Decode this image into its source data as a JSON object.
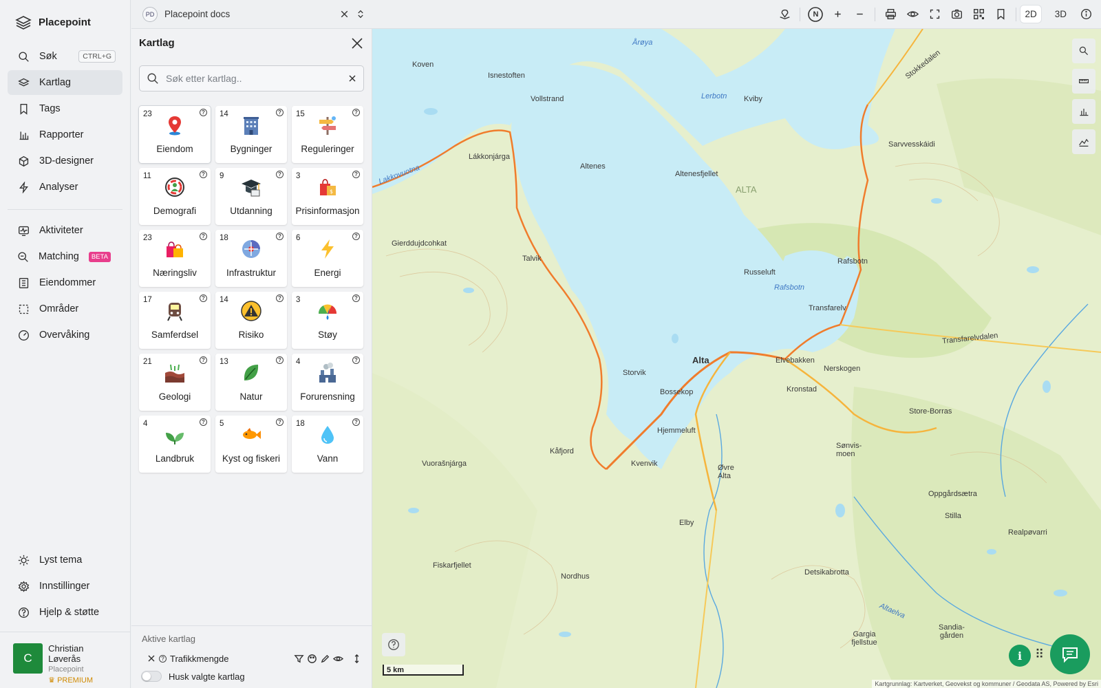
{
  "app": {
    "name": "Placepoint"
  },
  "nav": {
    "search": {
      "label": "Søk",
      "shortcut": "CTRL+G"
    },
    "items": [
      {
        "label": "Kartlag",
        "icon": "layers-icon",
        "active": true
      },
      {
        "label": "Tags",
        "icon": "bookmark-icon"
      },
      {
        "label": "Rapporter",
        "icon": "bar-chart-icon"
      },
      {
        "label": "3D-designer",
        "icon": "cube-icon"
      },
      {
        "label": "Analyser",
        "icon": "lightning-icon"
      }
    ],
    "items2": [
      {
        "label": "Aktiviteter",
        "icon": "activity-icon"
      },
      {
        "label": "Matching",
        "icon": "match-search-icon",
        "badge": "BETA"
      },
      {
        "label": "Eiendommer",
        "icon": "building-icon"
      },
      {
        "label": "Områder",
        "icon": "area-select-icon"
      },
      {
        "label": "Overvåking",
        "icon": "gauge-icon"
      }
    ],
    "bottom": [
      {
        "label": "Lyst tema",
        "icon": "sun-icon"
      },
      {
        "label": "Innstillinger",
        "icon": "gear-icon"
      },
      {
        "label": "Hjelp & støtte",
        "icon": "help-circle-icon"
      }
    ]
  },
  "user": {
    "initial": "C",
    "name": "Christian Løverås",
    "org": "Placepoint",
    "plan": "PREMIUM"
  },
  "topbar": {
    "project_badge": "PD",
    "project_name": "Placepoint docs",
    "compass": "N",
    "dim_2d": "2D",
    "dim_3d": "3D",
    "active_dim": "2D"
  },
  "panel": {
    "title": "Kartlag",
    "search_placeholder": "Søk etter kartlag..",
    "categories": [
      {
        "count": "23",
        "name": "Eiendom",
        "icon": "location-pin-icon",
        "selected": true
      },
      {
        "count": "14",
        "name": "Bygninger",
        "icon": "office-building-icon"
      },
      {
        "count": "15",
        "name": "Reguleringer",
        "icon": "signpost-icon"
      },
      {
        "count": "11",
        "name": "Demografi",
        "icon": "people-circle-icon"
      },
      {
        "count": "9",
        "name": "Utdanning",
        "icon": "graduation-cap-icon"
      },
      {
        "count": "3",
        "name": "Prisinformasjon",
        "icon": "price-bag-icon"
      },
      {
        "count": "23",
        "name": "Næringsliv",
        "icon": "shopping-bags-icon"
      },
      {
        "count": "18",
        "name": "Infrastruktur",
        "icon": "infrastructure-icon"
      },
      {
        "count": "6",
        "name": "Energi",
        "icon": "lightning-bolt-icon"
      },
      {
        "count": "17",
        "name": "Samferdsel",
        "icon": "train-icon"
      },
      {
        "count": "14",
        "name": "Risiko",
        "icon": "hazard-icon"
      },
      {
        "count": "3",
        "name": "Støy",
        "icon": "noise-gauge-icon"
      },
      {
        "count": "21",
        "name": "Geologi",
        "icon": "soil-layers-icon"
      },
      {
        "count": "13",
        "name": "Natur",
        "icon": "leaf-icon"
      },
      {
        "count": "4",
        "name": "Forurensning",
        "icon": "factory-icon"
      },
      {
        "count": "4",
        "name": "Landbruk",
        "icon": "sprout-icon"
      },
      {
        "count": "5",
        "name": "Kyst og fiskeri",
        "icon": "fish-icon"
      },
      {
        "count": "18",
        "name": "Vann",
        "icon": "water-drop-icon"
      }
    ],
    "active_title": "Aktive kartlag",
    "active_layers": [
      {
        "name": "Trafikkmengde"
      }
    ],
    "remember_label": "Husk valgte kartlag"
  },
  "map": {
    "labels": [
      "Koven",
      "Isnestoften",
      "Vollstrand",
      "Årøya",
      "Lakkovuotna",
      "Lákkonjárga",
      "Altenes",
      "Altenesfjellet",
      "ALTA",
      "Kviby",
      "Sarvvesskáidi",
      "Gierddujdcohkat",
      "Talvik",
      "Russeluft",
      "Rafsbotn",
      "Rafsbotn",
      "Transfarelv",
      "Transfarelvdalen",
      "Storvik",
      "Alta",
      "Bossekop",
      "Elvebakken",
      "Nerskogen",
      "Kronstad",
      "Store-Borras",
      "Hjemmeluft",
      "Kåfjord",
      "Vuorašnjárga",
      "Kvenvik",
      "Sønvis-moen",
      "Øvre Alta",
      "Oppgårdsætra",
      "Elby",
      "Stilla",
      "Realpøvarri",
      "Fiskarfjellet",
      "Nordhus",
      "Detsikabrotta",
      "Altaelva",
      "Gargia fjellstue",
      "Sandia-gården",
      "Lerbotn",
      "Stokkedalen"
    ],
    "scale": "5 km",
    "attribution": "Kartgrunnlag: Kartverket, Geovekst og kommuner / Geodata AS, Powered by Esri"
  }
}
